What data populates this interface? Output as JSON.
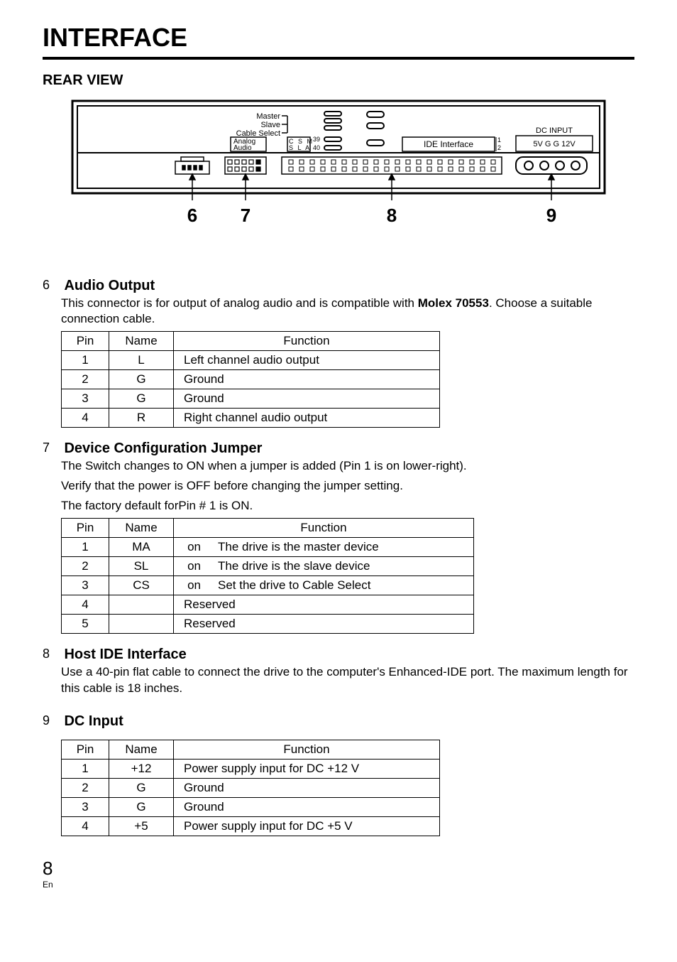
{
  "header": {
    "title": "INTERFACE",
    "subhead": "REAR VIEW"
  },
  "diagram_labels": {
    "master": "Master",
    "slave": "Slave",
    "cable_select": "Cable Select",
    "analog_audio": "Analog\nAudio",
    "csm": "C S M",
    "sla": "S L A",
    "p39": "39",
    "p40": "40",
    "ide": "IDE Interface",
    "ide_1": "1",
    "ide_2": "2",
    "dc_title": "DC INPUT",
    "dc_pins": "5V G G 12V",
    "n6": "6",
    "n7": "7",
    "n8": "8",
    "n9": "9"
  },
  "sections": {
    "s6": {
      "num": "6",
      "head": "Audio Output",
      "p1_a": "This connector is for output of analog audio and is compatible with  ",
      "p1_b": "Molex 70553",
      "p1_c": ".  Choose a suitable connection cable.",
      "table": {
        "h_pin": "Pin",
        "h_name": "Name",
        "h_func": "Function",
        "rows": [
          {
            "pin": "1",
            "name": "L",
            "func": "Left channel audio output"
          },
          {
            "pin": "2",
            "name": "G",
            "func": "Ground"
          },
          {
            "pin": "3",
            "name": "G",
            "func": "Ground"
          },
          {
            "pin": "4",
            "name": "R",
            "func": "Right channel audio output"
          }
        ]
      }
    },
    "s7": {
      "num": "7",
      "head": "Device Configuration Jumper",
      "p1": "The Switch changes to ON when a jumper is added (Pin 1 is on lower-right).",
      "p2": "Verify that the power is OFF before changing the jumper setting.",
      "p3": "The factory default forPin # 1 is ON.",
      "table": {
        "h_pin": "Pin",
        "h_name": "Name",
        "h_func": "Function",
        "rows": [
          {
            "pin": "1",
            "name": "MA",
            "on": "on",
            "func": "The drive is the master device"
          },
          {
            "pin": "2",
            "name": "SL",
            "on": "on",
            "func": "The drive is the slave device"
          },
          {
            "pin": "3",
            "name": "CS",
            "on": "on",
            "func": "Set the drive to Cable Select"
          },
          {
            "pin": "4",
            "name": "",
            "on": "",
            "func": "Reserved"
          },
          {
            "pin": "5",
            "name": "",
            "on": "",
            "func": "Reserved"
          }
        ]
      }
    },
    "s8": {
      "num": "8",
      "head": "Host IDE Interface",
      "p1": "Use a 40-pin flat cable to connect the drive to the computer's Enhanced-IDE port. The maximum length for this cable is 18 inches."
    },
    "s9": {
      "num": "9",
      "head": "DC Input",
      "table": {
        "h_pin": "Pin",
        "h_name": "Name",
        "h_func": "Function",
        "rows": [
          {
            "pin": "1",
            "name": "+12",
            "func": "Power supply input for DC +12 V"
          },
          {
            "pin": "2",
            "name": "G",
            "func": "Ground"
          },
          {
            "pin": "3",
            "name": "G",
            "func": "Ground"
          },
          {
            "pin": "4",
            "name": "+5",
            "func": "Power supply input for DC +5 V"
          }
        ]
      }
    }
  },
  "footer": {
    "page": "8",
    "lang": "En"
  }
}
